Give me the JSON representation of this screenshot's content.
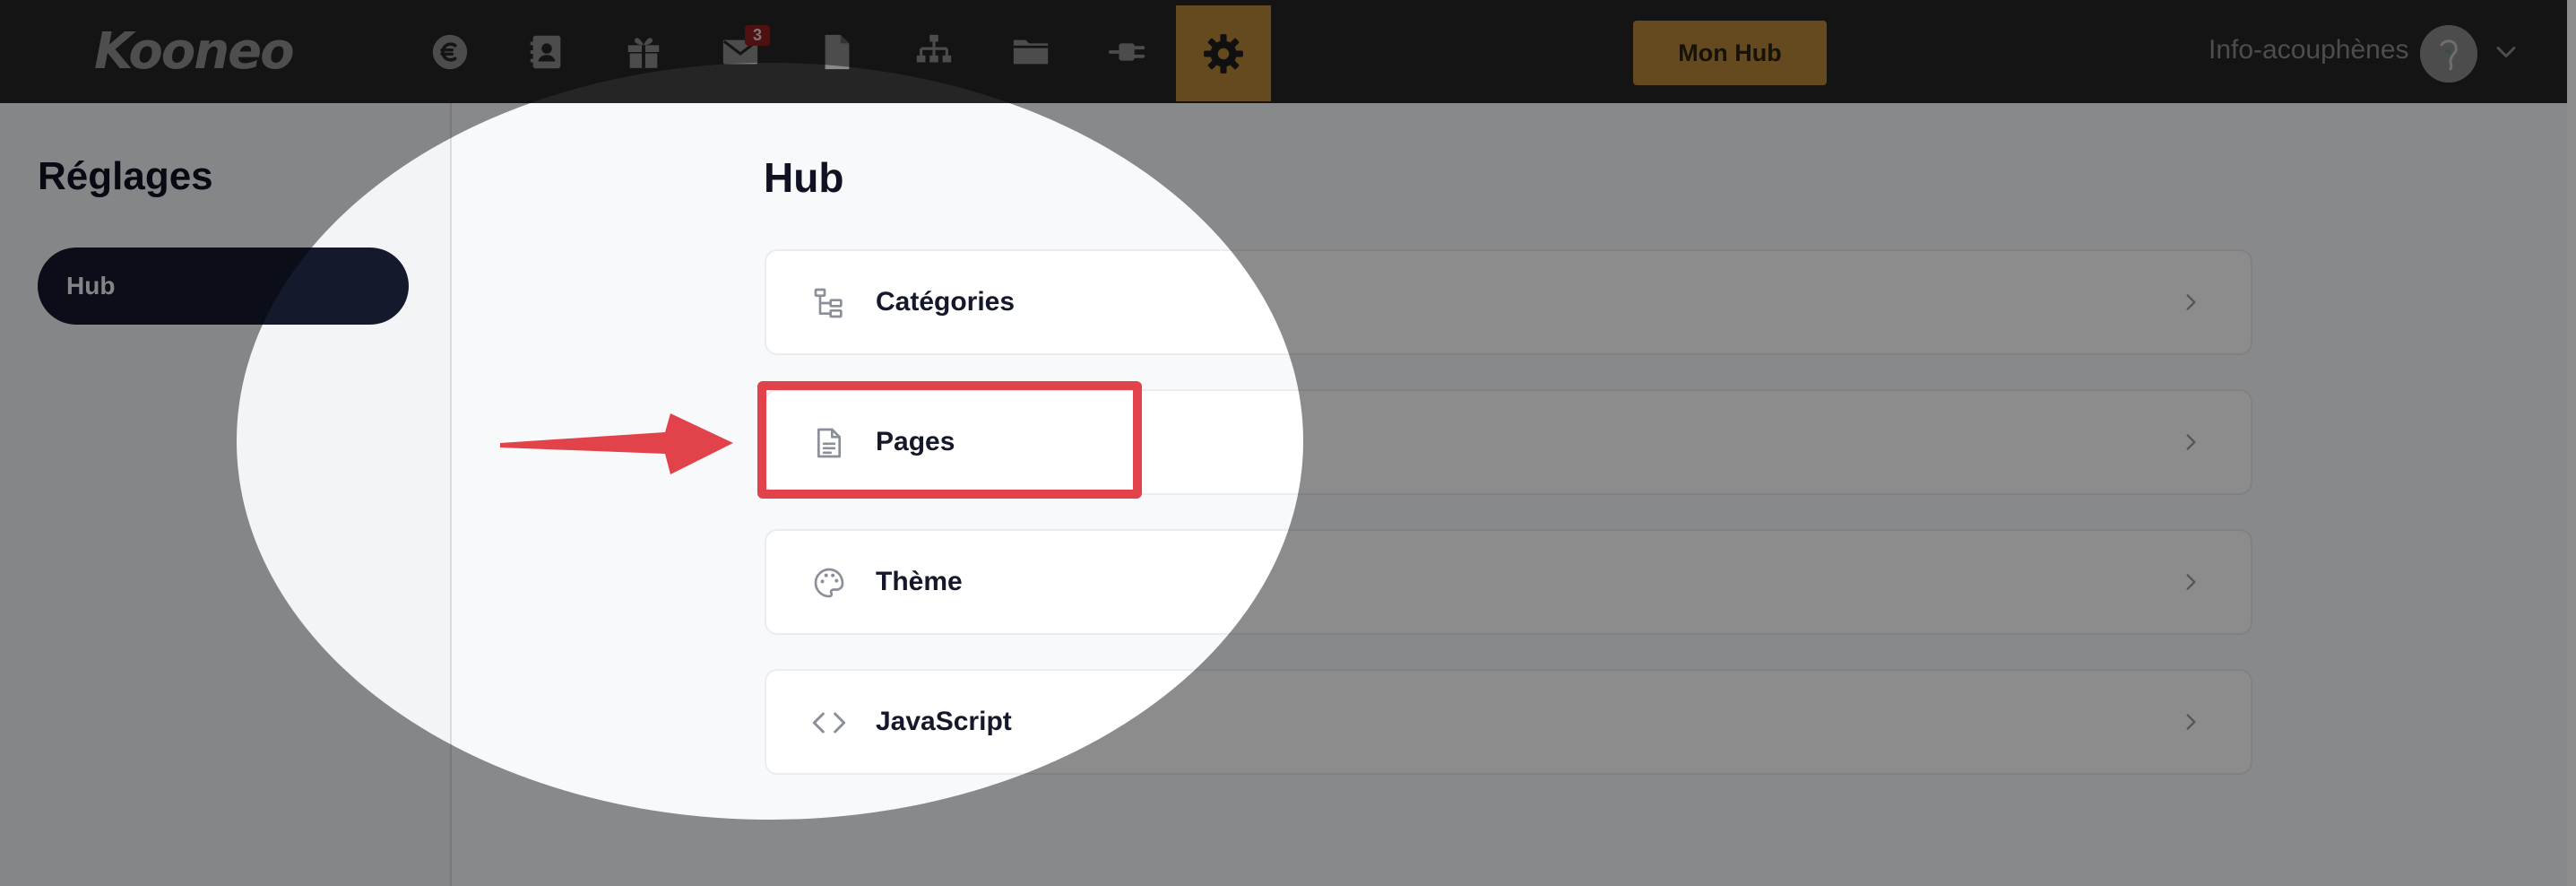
{
  "app": {
    "logo_text": "Kooneo"
  },
  "topbar": {
    "nav_icons": [
      "euro-icon",
      "contacts-icon",
      "gift-icon",
      "mail-icon",
      "document-icon",
      "sitemap-icon",
      "folder-icon",
      "plug-icon",
      "settings-icon"
    ],
    "mail_badge": "3",
    "active_nav": "settings-icon",
    "cta_label": "Mon Hub",
    "account_name": "Info-acouphènes"
  },
  "sidebar": {
    "title": "Réglages",
    "items": [
      {
        "label": "Hub",
        "active": true
      }
    ]
  },
  "main": {
    "title": "Hub",
    "items": [
      {
        "label": "Catégories",
        "icon": "category-tree-icon"
      },
      {
        "label": "Pages",
        "icon": "page-document-icon"
      },
      {
        "label": "Thème",
        "icon": "palette-icon"
      },
      {
        "label": "JavaScript",
        "icon": "code-icon"
      }
    ]
  },
  "annotation": {
    "highlighted_item": "Pages",
    "arrow_color": "#e2434b",
    "box_color": "#e2434b"
  },
  "colors": {
    "topbar_bg": "#252525",
    "accent": "#b9863a",
    "sidebar_active_bg": "#141a2c",
    "dim_overlay": "#000000"
  }
}
